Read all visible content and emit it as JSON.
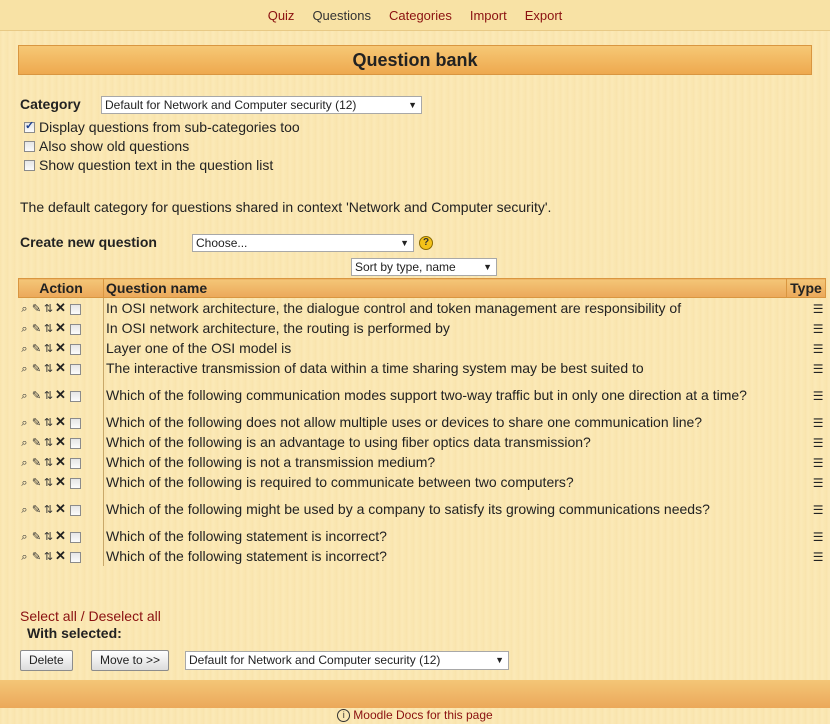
{
  "nav": {
    "items": [
      {
        "label": "Quiz",
        "active": false
      },
      {
        "label": "Questions",
        "active": true
      },
      {
        "label": "Categories",
        "active": false
      },
      {
        "label": "Import",
        "active": false
      },
      {
        "label": "Export",
        "active": false
      }
    ]
  },
  "page_title": "Question bank",
  "category": {
    "label": "Category",
    "selected": "Default for Network and Computer security (12)"
  },
  "options": {
    "subcategories": {
      "label": "Display questions from sub-categories too",
      "checked": true
    },
    "old_questions": {
      "label": "Also show old questions",
      "checked": false
    },
    "question_text": {
      "label": "Show question text in the question list",
      "checked": false
    }
  },
  "info_text": "The default category for questions shared in context 'Network and Computer security'.",
  "create": {
    "label": "Create new question",
    "selected": "Choose...",
    "help_icon": "help-icon"
  },
  "sort": {
    "selected": "Sort by type, name"
  },
  "table": {
    "headers": {
      "action": "Action",
      "name": "Question name",
      "type": "Type"
    },
    "rows": [
      {
        "name": "In OSI network architecture, the dialogue control and token management are responsibility of",
        "tall": false
      },
      {
        "name": "In OSI network architecture, the routing is performed by",
        "tall": false
      },
      {
        "name": "Layer one of the OSI model is",
        "tall": false
      },
      {
        "name": "The interactive transmission of data within a time sharing system may be best suited to",
        "tall": false
      },
      {
        "name": "Which of the following communication modes support two-way traffic but in only one direction at a time?",
        "tall": true
      },
      {
        "name": "Which of the following does not allow multiple uses or devices to share one communication line?",
        "tall": false
      },
      {
        "name": "Which of the following is an advantage to using fiber optics data transmission?",
        "tall": false
      },
      {
        "name": "Which of the following is not a transmission medium?",
        "tall": false
      },
      {
        "name": "Which of the following is required to communicate between two computers?",
        "tall": false
      },
      {
        "name": "Which of the following might be used by a company to satisfy its growing communications needs?",
        "tall": true
      },
      {
        "name": "Which of the following statement is incorrect?",
        "tall": false
      },
      {
        "name": "Which of the following statement is incorrect?",
        "tall": false
      }
    ],
    "action_icons": [
      "preview-icon",
      "edit-icon",
      "move-icon",
      "delete-icon"
    ],
    "type_icon": "multichoice-icon"
  },
  "select_links": {
    "select_all": "Select all",
    "separator": " / ",
    "deselect_all": "Deselect all"
  },
  "with_selected": {
    "label": "With selected:",
    "delete_label": "Delete",
    "move_label": "Move to >>",
    "move_target": "Default for Network and Computer security (12)"
  },
  "footer": {
    "docs_link": "Moodle Docs for this page"
  }
}
